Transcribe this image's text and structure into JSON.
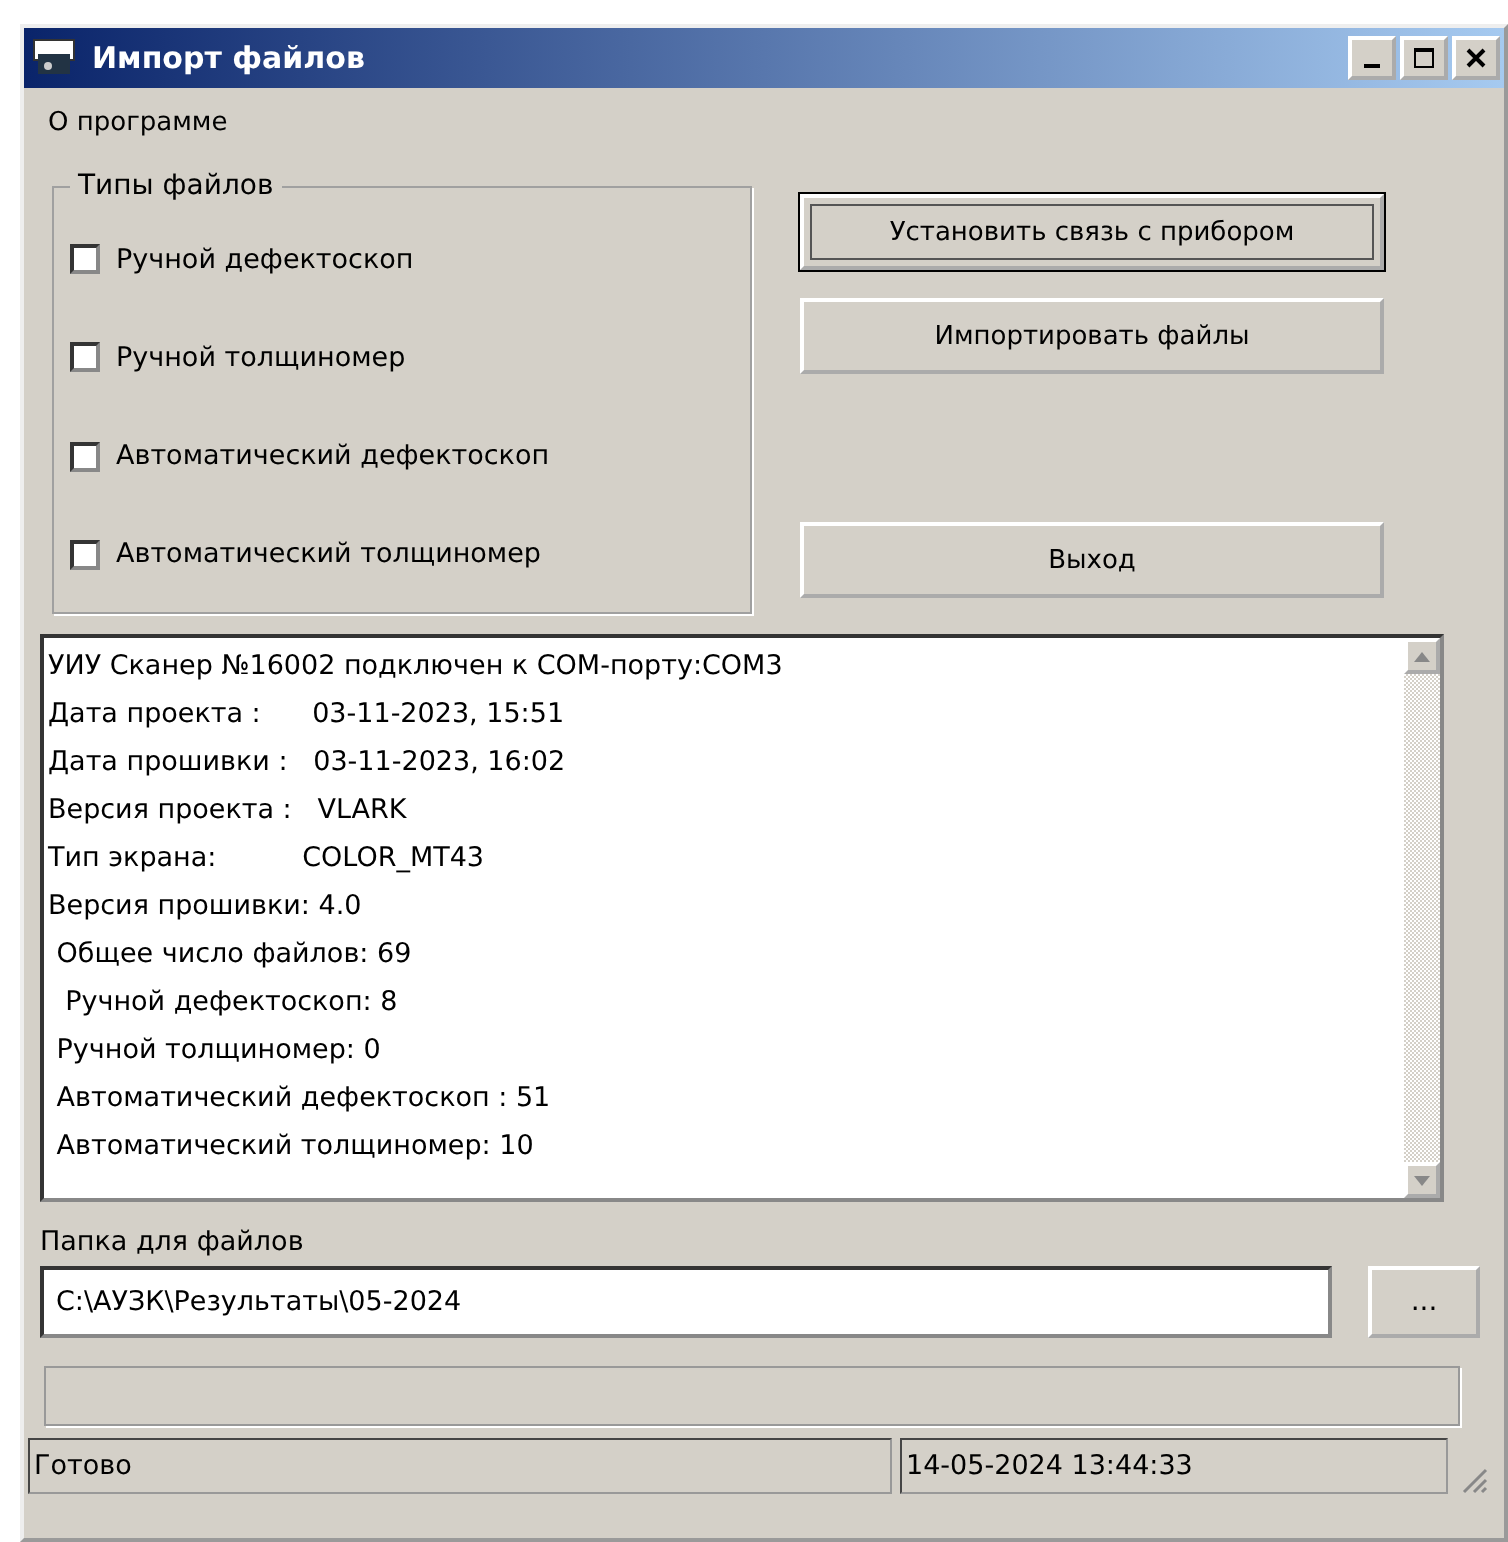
{
  "window": {
    "title": "Импорт файлов"
  },
  "menu": [
    {
      "label": "О программе"
    }
  ],
  "file_types": {
    "title": "Типы файлов",
    "items": [
      {
        "label": "Ручной дефектоскоп",
        "checked": false
      },
      {
        "label": "Ручной толщиномер",
        "checked": false
      },
      {
        "label": "Автоматический дефектоскоп",
        "checked": false
      },
      {
        "label": "Автоматический толщиномер",
        "checked": false
      }
    ]
  },
  "buttons": [
    {
      "label": "Установить связь с прибором",
      "focused": true
    },
    {
      "label": "Импортировать файлы",
      "focused": false
    },
    {
      "label": "Выход",
      "focused": false
    }
  ],
  "log": [
    "УИУ Сканер №16002 подключен к COM-порту:COM3",
    "Дата проекта :      03-11-2023, 15:51",
    "Дата прошивки :   03-11-2023, 16:02",
    "Версия проекта :   VLARK",
    "Тип экрана:          COLOR_MT43",
    "Версия прошивки: 4.0",
    " Общее число файлов: 69",
    "  Ручной дефектоскоп: 8",
    " Ручной толщиномер: 0",
    " Автоматический дефектоскоп : 51",
    " Автоматический толщиномер: 10"
  ],
  "folder": {
    "label": "Папка для файлов",
    "value": "C:\\АУЗК\\Результаты\\05-2024",
    "browse": "..."
  },
  "progress": {
    "level": 0
  },
  "status_bar": [
    "Готово",
    "14-05-2024 13:44:33"
  ]
}
